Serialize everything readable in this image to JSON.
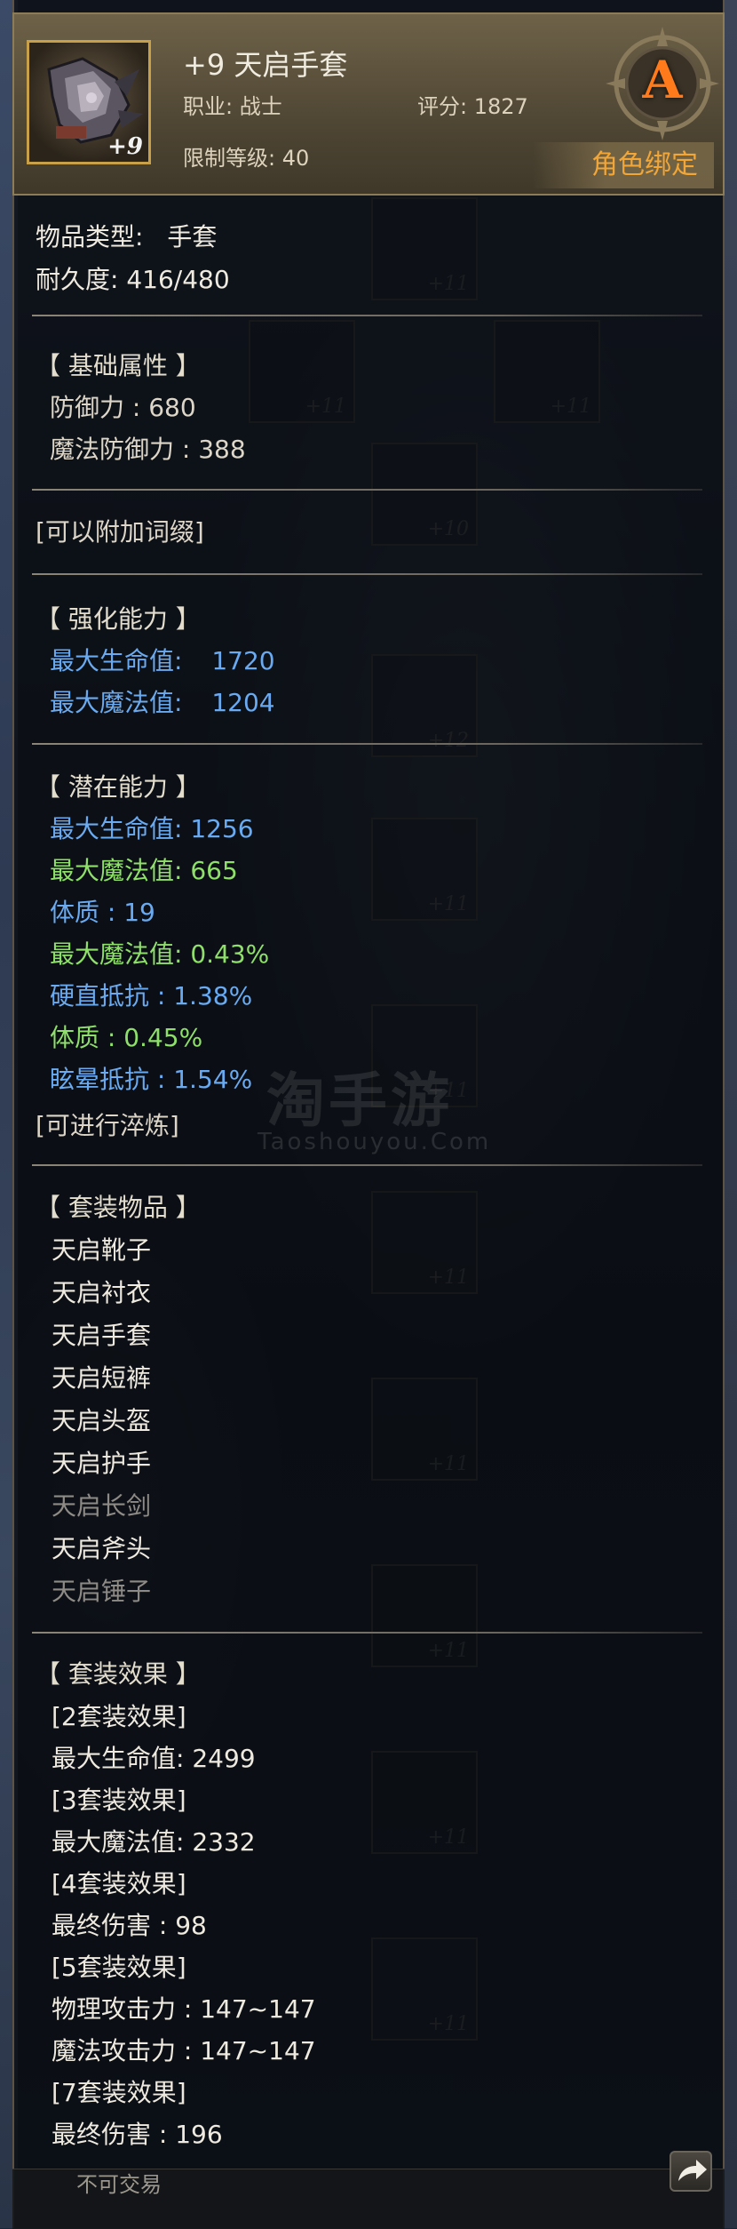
{
  "header": {
    "item_name": "+9 天启手套",
    "icon_enhance": "+9",
    "job_label": "职业: 战士",
    "score_label": "评分: 1827",
    "level_req_label": "限制等级: 40",
    "grade": "A",
    "bind_label": "角色绑定",
    "grade_color": "#ff7a1a",
    "bind_color": "#f2a637"
  },
  "basic": {
    "type_label": "物品类型:",
    "type_value": "手套",
    "durability": "耐久度:  416/480"
  },
  "base_stats": {
    "title": "【 基础属性 】",
    "rows": [
      "防御力 : 680",
      "魔法防御力 : 388"
    ]
  },
  "affix_hint": "[可以附加词缀]",
  "enhance": {
    "title": "【 强化能力 】",
    "rows": [
      {
        "label": "最大生命值:",
        "value": "1720"
      },
      {
        "label": "最大魔法值:",
        "value": "1204"
      }
    ]
  },
  "potential": {
    "title": "【 潜在能力 】",
    "rows": [
      {
        "text": "最大生命值:   1256",
        "color": "#6aaaf0"
      },
      {
        "text": "最大魔法值:   665",
        "color": "#8fe06a"
      },
      {
        "text": "体质 : 19",
        "color": "#6aaaf0"
      },
      {
        "text": "最大魔法值:   0.43%",
        "color": "#8fe06a"
      },
      {
        "text": "硬直抵抗 : 1.38%",
        "color": "#6aaaf0"
      },
      {
        "text": "体质 : 0.45%",
        "color": "#8fe06a"
      },
      {
        "text": "眩晕抵抗 : 1.54%",
        "color": "#6aaaf0"
      }
    ],
    "refine_hint": "[可进行淬炼]"
  },
  "set_items": {
    "title": "【 套装物品 】",
    "items": [
      {
        "name": "天启靴子",
        "owned": true
      },
      {
        "name": "天启衬衣",
        "owned": true
      },
      {
        "name": "天启手套",
        "owned": true
      },
      {
        "name": "天启短裤",
        "owned": true
      },
      {
        "name": "天启头盔",
        "owned": true
      },
      {
        "name": "天启护手",
        "owned": true
      },
      {
        "name": "天启长剑",
        "owned": false
      },
      {
        "name": "天启斧头",
        "owned": true
      },
      {
        "name": "天启锤子",
        "owned": false
      }
    ]
  },
  "set_effects": {
    "title": "【 套装效果 】",
    "rows": [
      "[2套装效果]",
      "最大生命值:   2499",
      "[3套装效果]",
      "最大魔法值:   2332",
      "[4套装效果]",
      "最终伤害 : 98",
      "[5套装效果]",
      "物理攻击力 : 147~147",
      "魔法攻击力 : 147~147",
      "[7套装效果]",
      "最终伤害 : 196"
    ]
  },
  "watermark": {
    "main": "淘手游",
    "sub": "Taoshouyou.Com"
  },
  "footer": {
    "trade_label": "不可交易",
    "share_icon": "share-arrow-icon"
  }
}
